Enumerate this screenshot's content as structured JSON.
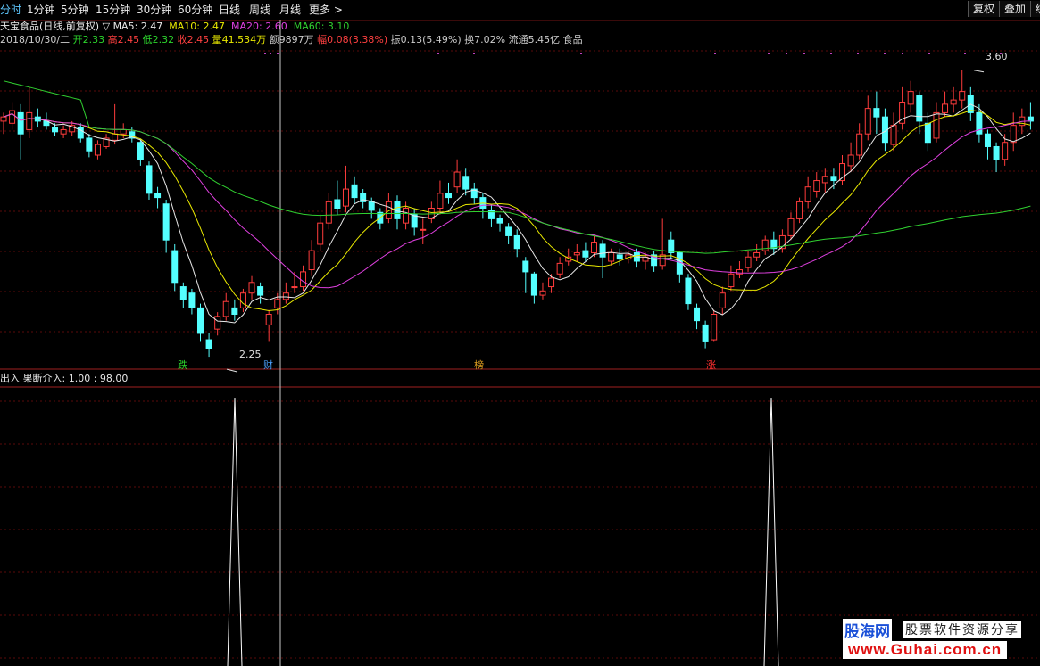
{
  "toolbar": {
    "tabs": [
      "分时",
      "1分钟",
      "5分钟",
      "15分钟",
      "30分钟",
      "60分钟",
      "日线",
      "周线",
      "月线",
      "更多 >"
    ],
    "active_tab": "分时",
    "right_buttons": [
      "复权",
      "叠加",
      "统"
    ]
  },
  "header": {
    "title": "天宝食品(日线,前复权)",
    "ma_toggle": "▽",
    "ma5": "MA5: 2.47",
    "ma10": "MA10: 2.47",
    "ma20": "MA20: 2.60",
    "ma60": "MA60: 3.10"
  },
  "quote": {
    "date": "2018/10/30/二",
    "open": "开2.33",
    "high": "高2.45",
    "low": "低2.32",
    "close": "收2.45",
    "volume": "量41.534万",
    "amount": "额9897万",
    "change": "幅0.08(3.38%)",
    "amplitude": "振0.13(5.49%)",
    "turnover": "换7.02%",
    "float_cap": "流通5.45亿",
    "sector": "食品"
  },
  "price_labels": {
    "high_mark": "3.60",
    "low_mark": "2.25"
  },
  "event_markers": [
    {
      "text": "跌",
      "color": "#2cd62c"
    },
    {
      "text": "财",
      "color": "#4aa0ff"
    },
    {
      "text": "榜",
      "color": "#e0a020"
    },
    {
      "text": "涨",
      "color": "#ff3030"
    }
  ],
  "indicator": {
    "label": "出入",
    "formula": "果断介入: 1.00 : 98.00"
  },
  "watermark": {
    "brand": "股海网",
    "slogan": "股票软件资源分享",
    "url": "www.Guhai.com.cn"
  },
  "colors": {
    "up": "#ff3c3c",
    "down": "#54ffff",
    "ma5": "#e8e8e8",
    "ma10": "#e8e800",
    "ma20": "#e040e0",
    "ma60": "#30d030",
    "grid": "#5a0a0a",
    "tab_active": "#5fc8ff",
    "signal": "#ffffff"
  },
  "chart_data": {
    "type": "candlestick",
    "period": "daily",
    "ylim": [
      2.2,
      3.7
    ],
    "annotated_high": 3.6,
    "annotated_low": 2.25,
    "candles": [
      [
        3.36,
        3.38,
        3.3,
        3.4
      ],
      [
        3.35,
        3.41,
        3.32,
        3.45
      ],
      [
        3.4,
        3.3,
        3.18,
        3.44
      ],
      [
        3.32,
        3.4,
        3.28,
        3.52
      ],
      [
        3.38,
        3.36,
        3.33,
        3.42
      ],
      [
        3.36,
        3.34,
        3.32,
        3.4
      ],
      [
        3.33,
        3.31,
        3.29,
        3.35
      ],
      [
        3.3,
        3.32,
        3.28,
        3.34
      ],
      [
        3.31,
        3.34,
        3.29,
        3.36
      ],
      [
        3.33,
        3.28,
        3.26,
        3.35
      ],
      [
        3.28,
        3.22,
        3.19,
        3.3
      ],
      [
        3.2,
        3.25,
        3.18,
        3.27
      ],
      [
        3.24,
        3.28,
        3.23,
        3.3
      ],
      [
        3.27,
        3.3,
        3.25,
        3.44
      ],
      [
        3.3,
        3.32,
        3.28,
        3.35
      ],
      [
        3.31,
        3.28,
        3.26,
        3.33
      ],
      [
        3.26,
        3.18,
        3.15,
        3.27
      ],
      [
        3.15,
        3.02,
        2.99,
        3.17
      ],
      [
        3.02,
        3.0,
        2.95,
        3.05
      ],
      [
        2.97,
        2.8,
        2.74,
        2.99
      ],
      [
        2.75,
        2.6,
        2.56,
        2.78
      ],
      [
        2.58,
        2.52,
        2.48,
        2.6
      ],
      [
        2.55,
        2.48,
        2.45,
        2.57
      ],
      [
        2.48,
        2.36,
        2.32,
        2.5
      ],
      [
        2.33,
        2.29,
        2.25,
        2.36
      ],
      [
        2.38,
        2.44,
        2.35,
        2.46
      ],
      [
        2.44,
        2.51,
        2.42,
        2.55
      ],
      [
        2.48,
        2.45,
        2.42,
        2.52
      ],
      [
        2.48,
        2.55,
        2.46,
        2.57
      ],
      [
        2.55,
        2.6,
        2.52,
        2.63
      ],
      [
        2.58,
        2.54,
        2.5,
        2.6
      ],
      [
        2.4,
        2.45,
        2.32,
        2.47
      ],
      [
        2.48,
        2.52,
        2.45,
        2.55
      ],
      [
        2.52,
        2.55,
        2.5,
        2.6
      ],
      [
        2.58,
        2.58,
        2.55,
        2.65
      ],
      [
        2.58,
        2.65,
        2.56,
        2.68
      ],
      [
        2.66,
        2.75,
        2.63,
        2.8
      ],
      [
        2.78,
        2.88,
        2.75,
        2.92
      ],
      [
        2.88,
        2.98,
        2.85,
        3.02
      ],
      [
        2.99,
        2.95,
        2.92,
        3.08
      ],
      [
        2.96,
        3.04,
        2.93,
        3.15
      ],
      [
        3.06,
        3.0,
        2.97,
        3.1
      ],
      [
        3.02,
        2.98,
        2.95,
        3.04
      ],
      [
        2.98,
        2.94,
        2.9,
        3.0
      ],
      [
        2.93,
        2.88,
        2.85,
        2.95
      ],
      [
        2.9,
        2.98,
        2.88,
        3.02
      ],
      [
        2.98,
        2.9,
        2.85,
        3.01
      ],
      [
        2.88,
        2.95,
        2.85,
        2.98
      ],
      [
        2.92,
        2.86,
        2.82,
        2.95
      ],
      [
        2.85,
        2.85,
        2.78,
        2.9
      ],
      [
        2.9,
        2.95,
        2.88,
        2.98
      ],
      [
        2.95,
        3.02,
        2.92,
        3.08
      ],
      [
        3.02,
        3.0,
        2.97,
        3.07
      ],
      [
        3.05,
        3.12,
        3.02,
        3.18
      ],
      [
        3.1,
        3.04,
        3.01,
        3.14
      ],
      [
        3.04,
        3.0,
        2.97,
        3.07
      ],
      [
        3.0,
        2.95,
        2.9,
        3.02
      ],
      [
        2.94,
        2.9,
        2.86,
        2.97
      ],
      [
        2.9,
        2.88,
        2.84,
        2.92
      ],
      [
        2.86,
        2.82,
        2.78,
        2.88
      ],
      [
        2.82,
        2.76,
        2.72,
        2.85
      ],
      [
        2.7,
        2.65,
        2.55,
        2.72
      ],
      [
        2.64,
        2.54,
        2.5,
        2.65
      ],
      [
        2.54,
        2.56,
        2.52,
        2.6
      ],
      [
        2.58,
        2.62,
        2.55,
        2.64
      ],
      [
        2.64,
        2.69,
        2.62,
        2.72
      ],
      [
        2.7,
        2.72,
        2.68,
        2.76
      ],
      [
        2.73,
        2.74,
        2.7,
        2.78
      ],
      [
        2.75,
        2.72,
        2.7,
        2.79
      ],
      [
        2.74,
        2.79,
        2.72,
        2.82
      ],
      [
        2.78,
        2.72,
        2.62,
        2.8
      ],
      [
        2.7,
        2.74,
        2.68,
        2.76
      ],
      [
        2.73,
        2.71,
        2.68,
        2.76
      ],
      [
        2.71,
        2.73,
        2.69,
        2.75
      ],
      [
        2.74,
        2.7,
        2.67,
        2.76
      ],
      [
        2.7,
        2.72,
        2.66,
        2.74
      ],
      [
        2.73,
        2.68,
        2.65,
        2.75
      ],
      [
        2.68,
        2.73,
        2.66,
        2.9
      ],
      [
        2.8,
        2.74,
        2.71,
        2.84
      ],
      [
        2.74,
        2.64,
        2.6,
        2.75
      ],
      [
        2.62,
        2.5,
        2.47,
        2.64
      ],
      [
        2.48,
        2.42,
        2.38,
        2.5
      ],
      [
        2.4,
        2.32,
        2.29,
        2.42
      ],
      [
        2.33,
        2.45,
        2.32,
        2.47
      ],
      [
        2.48,
        2.55,
        2.45,
        2.58
      ],
      [
        2.58,
        2.64,
        2.56,
        2.68
      ],
      [
        2.64,
        2.66,
        2.62,
        2.7
      ],
      [
        2.67,
        2.72,
        2.65,
        2.75
      ],
      [
        2.72,
        2.74,
        2.7,
        2.78
      ],
      [
        2.75,
        2.8,
        2.73,
        2.82
      ],
      [
        2.8,
        2.76,
        2.73,
        2.84
      ],
      [
        2.76,
        2.82,
        2.74,
        2.85
      ],
      [
        2.82,
        2.9,
        2.8,
        2.93
      ],
      [
        2.9,
        2.98,
        2.88,
        3.0
      ],
      [
        2.98,
        3.05,
        2.95,
        3.1
      ],
      [
        3.03,
        3.08,
        3.0,
        3.12
      ],
      [
        3.07,
        3.1,
        3.02,
        3.14
      ],
      [
        3.1,
        3.08,
        3.04,
        3.14
      ],
      [
        3.08,
        3.16,
        3.06,
        3.2
      ],
      [
        3.15,
        3.2,
        3.12,
        3.26
      ],
      [
        3.2,
        3.3,
        3.18,
        3.35
      ],
      [
        3.3,
        3.42,
        3.27,
        3.48
      ],
      [
        3.42,
        3.38,
        3.3,
        3.5
      ],
      [
        3.38,
        3.26,
        3.22,
        3.42
      ],
      [
        3.25,
        3.34,
        3.22,
        3.4
      ],
      [
        3.35,
        3.45,
        3.32,
        3.52
      ],
      [
        3.44,
        3.5,
        3.4,
        3.55
      ],
      [
        3.48,
        3.36,
        3.3,
        3.5
      ],
      [
        3.35,
        3.26,
        3.22,
        3.4
      ],
      [
        3.28,
        3.4,
        3.26,
        3.45
      ],
      [
        3.4,
        3.44,
        3.38,
        3.5
      ],
      [
        3.44,
        3.46,
        3.4,
        3.52
      ],
      [
        3.46,
        3.5,
        3.42,
        3.6
      ],
      [
        3.48,
        3.4,
        3.36,
        3.52
      ],
      [
        3.4,
        3.3,
        3.26,
        3.44
      ],
      [
        3.3,
        3.24,
        3.18,
        3.32
      ],
      [
        3.24,
        3.18,
        3.12,
        3.26
      ],
      [
        3.18,
        3.26,
        3.15,
        3.3
      ],
      [
        3.26,
        3.34,
        3.22,
        3.4
      ],
      [
        3.34,
        3.38,
        3.3,
        3.42
      ],
      [
        3.38,
        3.36,
        3.32,
        3.45
      ]
    ]
  }
}
